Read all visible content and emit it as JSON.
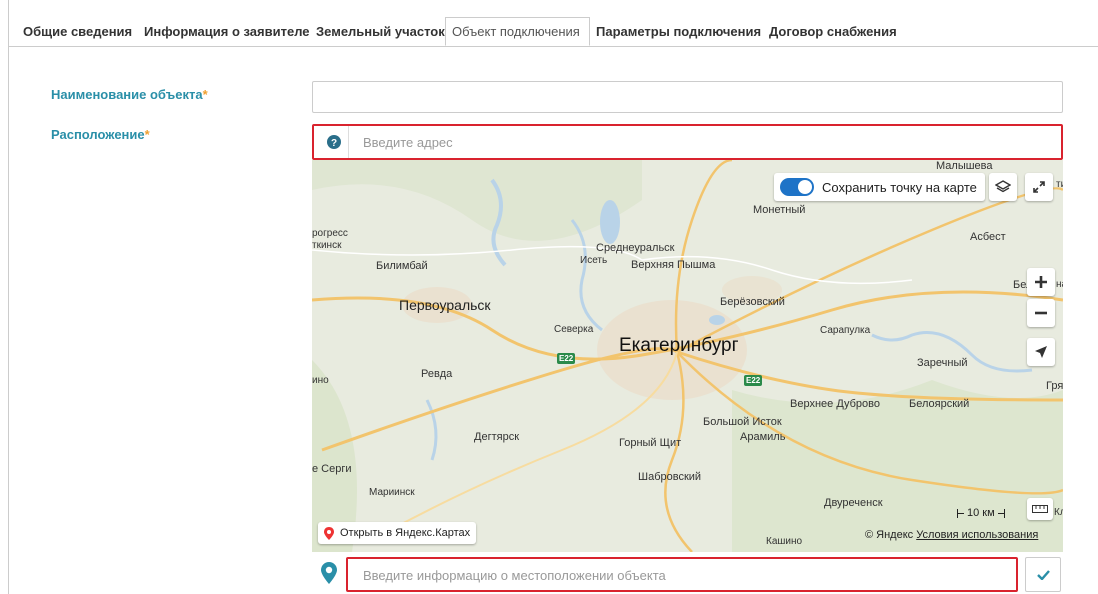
{
  "tabs": [
    {
      "label": "Общие сведения",
      "active": false
    },
    {
      "label": "Информация о заявителе",
      "active": false
    },
    {
      "label": "Земельный участок",
      "active": false
    },
    {
      "label": "Объект подключения",
      "active": true
    },
    {
      "label": "Параметры подключения",
      "active": false
    },
    {
      "label": "Договор снабжения",
      "active": false
    }
  ],
  "form": {
    "object_name_label": "Наименование объекта",
    "object_name_value": "",
    "location_label": "Расположение",
    "required_mark": "*",
    "address_placeholder": "Введите адрес",
    "location_info_placeholder": "Введите информацию о местоположении объекта"
  },
  "map": {
    "save_point_label": "Сохранить точку на карте",
    "open_in_yandex": "Открыть в Яндекс.Картах",
    "copyright": "© Яндекс",
    "terms_link": "Условия использования",
    "scale": "10 км",
    "cities": {
      "ekb": "Екатеринбург",
      "pervouralsk": "Первоуральск",
      "malysheva": "Малышева",
      "monetny": "Монетный",
      "asbest": "Асбест",
      "progress": "рогресс",
      "tkinsk": "ткинск",
      "bilimbay": "Билимбай",
      "sredneuralsk": "Среднеуральск",
      "iset": "Исеть",
      "vpyshma": "Верхняя Пышма",
      "belo": "Бело",
      "berezovsky": "Берёзовский",
      "severka": "Северка",
      "sarapulka": "Сарапулка",
      "zarechny": "Заречный",
      "ino": "ино",
      "revda": "Ревда",
      "gry": "Гря",
      "vdubrovo": "Верхнее Дуброво",
      "beloyarsky": "Белоярский",
      "bistok": "Большой Исток",
      "aramil": "Арамиль",
      "degtyarsk": "Дегтярск",
      "gshchit": "Горный Щит",
      "eserги": "е Серги",
      "shabrovsky": "Шабровский",
      "mariinsk": "Мариинск",
      "dvurechensk": "Двуреченск",
      "kashino": "Кашино",
      "kl": "Кл",
      "ti": "ти",
      "hi": "на"
    },
    "road_e22_a": "E22",
    "road_e22_b": "E22"
  },
  "colors": {
    "label": "#2a8fa8",
    "required": "#f0a030",
    "highlight_border": "#d9232e",
    "toggle": "#1e73c7",
    "pin": "#2a8fa8",
    "check": "#2a8fa8"
  }
}
